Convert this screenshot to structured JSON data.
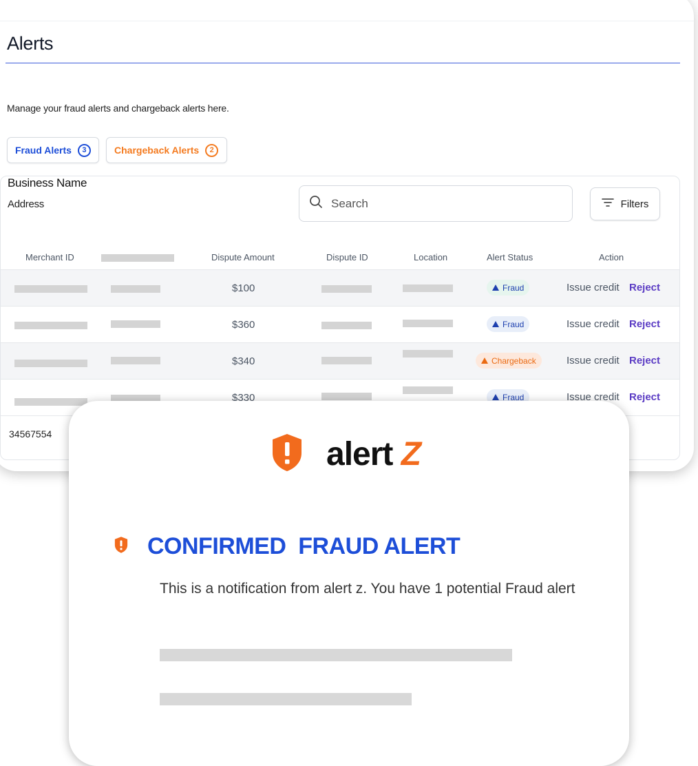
{
  "dashboard": {
    "title": "Alerts",
    "subtitle": "Manage your fraud alerts and chargeback alerts here.",
    "tabs": [
      {
        "label": "Fraud Alerts",
        "count": "3",
        "color": "#1d4ed8"
      },
      {
        "label": "Chargeback Alerts",
        "count": "2",
        "color": "#f47b20"
      }
    ],
    "business": {
      "name": "Business Name",
      "address": "Address"
    },
    "search": {
      "placeholder": "Search",
      "icon": "search-icon"
    },
    "filters": {
      "label": "Filters",
      "icon": "filter-lines-icon"
    },
    "columns": [
      "Merchant ID",
      "Dispute Amount",
      "Dispute ID",
      "Location",
      "Alert Status",
      "Action"
    ],
    "rows": [
      {
        "amount": "$100",
        "status": "Fraud",
        "status_type": "fraud",
        "actions": [
          "Issue credit",
          "Reject"
        ]
      },
      {
        "amount": "$360",
        "status": "Fraud",
        "status_type": "fraud",
        "actions": [
          "Issue credit",
          "Reject"
        ]
      },
      {
        "amount": "$340",
        "status": "Chargeback",
        "status_type": "chargeback",
        "actions": [
          "Issue credit",
          "Reject"
        ]
      },
      {
        "amount": "$330",
        "status": "Fraud",
        "status_type": "fraud",
        "actions": [
          "Issue credit",
          "Reject"
        ]
      }
    ],
    "partial_merchant_id": "34567554"
  },
  "notification": {
    "brand": {
      "name": "alert",
      "accent": "Z",
      "logo_icon": "shield-exclamation-icon",
      "accent_color": "#f26b1d"
    },
    "title": "CONFIRMED  FRAUD ALERT",
    "title_icon": "shield-exclamation-icon",
    "message": "This is a notification from alert z. You have 1 potential Fraud alert"
  },
  "colors": {
    "primary_blue": "#1d4ed8",
    "orange": "#f26b1d",
    "reject_purple": "#5b3cc4"
  }
}
